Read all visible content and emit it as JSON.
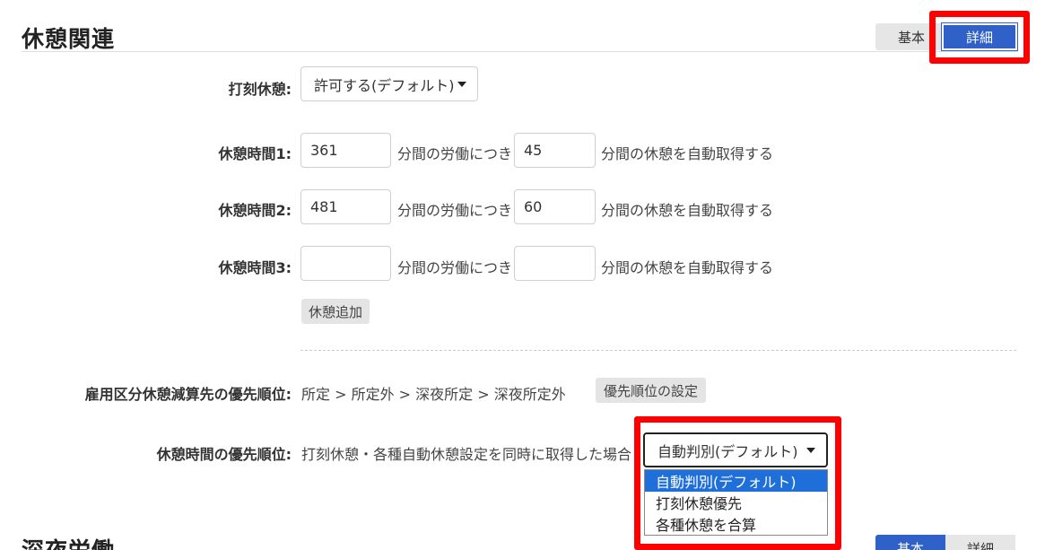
{
  "section1": {
    "title": "休憩関連",
    "mode_basic": "基本",
    "mode_detail": "詳細"
  },
  "stamp_break": {
    "label": "打刻休憩:",
    "value": "許可する(デフォルト)"
  },
  "break_rows": [
    {
      "label": "休憩時間1:",
      "work_minutes": "361",
      "mid_text": "分間の労働につき",
      "break_minutes": "45",
      "tail_text": "分間の休憩を自動取得する"
    },
    {
      "label": "休憩時間2:",
      "work_minutes": "481",
      "mid_text": "分間の労働につき",
      "break_minutes": "60",
      "tail_text": "分間の休憩を自動取得する"
    },
    {
      "label": "休憩時間3:",
      "work_minutes": "",
      "mid_text": "分間の労働につき",
      "break_minutes": "",
      "tail_text": "分間の休憩を自動取得する"
    }
  ],
  "add_break_button": "休憩追加",
  "priority_order": {
    "label": "雇用区分休憩減算先の優先順位:",
    "value": "所定 > 所定外 > 深夜所定 > 深夜所定外",
    "button": "優先順位の設定"
  },
  "break_priority": {
    "label": "休憩時間の優先順位:",
    "description": "打刻休憩・各種自動休憩設定を同時に取得した場合",
    "selected": "自動判別(デフォルト)",
    "options": [
      "自動判別(デフォルト)",
      "打刻休憩優先",
      "各種休憩を合算"
    ]
  },
  "section2": {
    "title": "深夜労働",
    "mode_basic": "基本",
    "mode_detail": "詳細"
  },
  "colors": {
    "accent": "#2f61c9",
    "highlight": "#ff0000",
    "selected_option": "#1e6fd9"
  }
}
